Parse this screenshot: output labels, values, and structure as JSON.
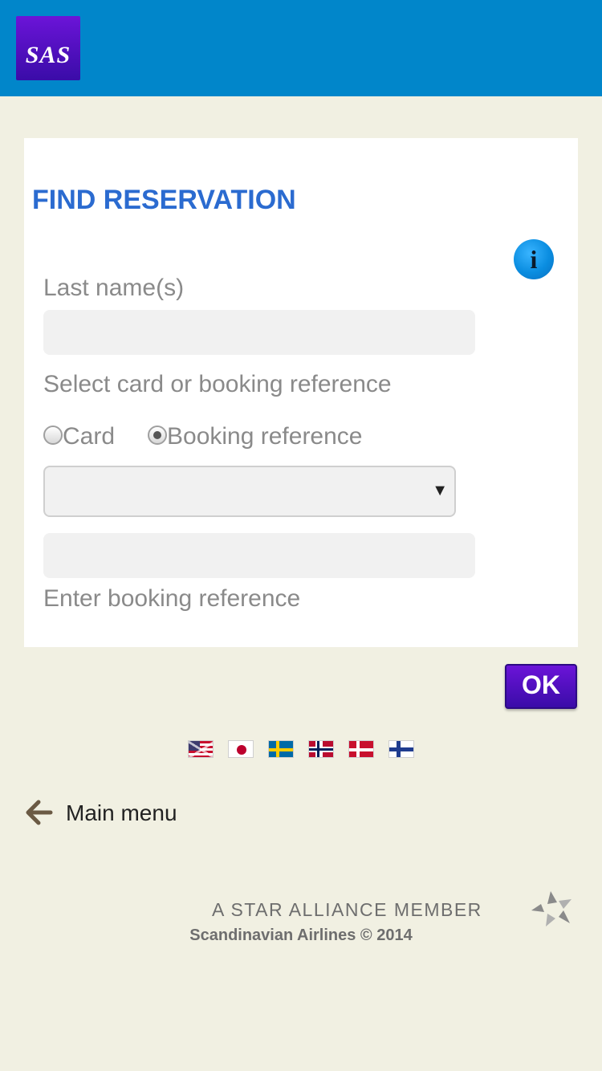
{
  "header": {
    "logo_text": "SAS",
    "background_color": "#0186ca"
  },
  "form": {
    "title": "FIND RESERVATION",
    "info_icon_glyph": "i",
    "last_name_label": "Last name(s)",
    "last_name_value": "",
    "select_label": "Select card or booking reference",
    "radio_card_label": "Card",
    "radio_card_checked": false,
    "radio_booking_label": "Booking reference",
    "radio_booking_checked": true,
    "select_value": "",
    "booking_ref_value": "",
    "booking_ref_hint": "Enter booking reference"
  },
  "ok_button": {
    "label": "OK"
  },
  "languages": [
    {
      "icon": "flag-uk-icon"
    },
    {
      "icon": "flag-jp-icon"
    },
    {
      "icon": "flag-se-icon"
    },
    {
      "icon": "flag-no-icon"
    },
    {
      "icon": "flag-dk-icon"
    },
    {
      "icon": "flag-fi-icon"
    }
  ],
  "nav": {
    "main_menu_label": "Main menu"
  },
  "footer": {
    "alliance_text": "A STAR ALLIANCE MEMBER",
    "copyright": "Scandinavian Airlines © 2014"
  },
  "colors": {
    "page_bg": "#f1f0e2",
    "title_blue": "#2b6bd0",
    "brand_purple": "#4a0fc0"
  }
}
